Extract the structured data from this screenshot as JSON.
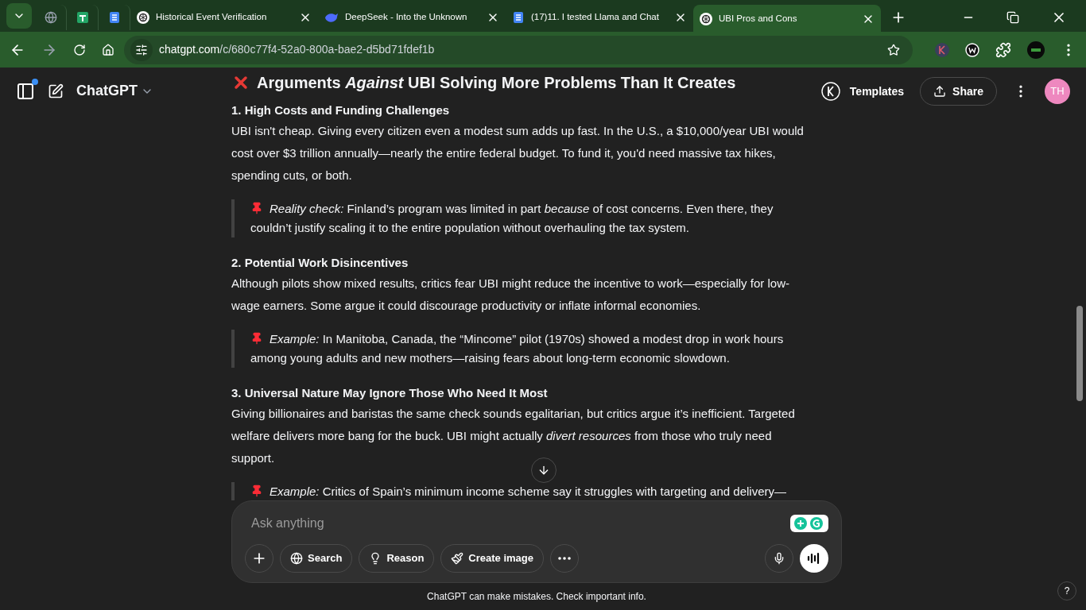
{
  "browser": {
    "tabs": [
      {
        "kind": "pinned",
        "selected": false
      },
      {
        "kind": "pinned",
        "selected": false
      },
      {
        "kind": "pinned",
        "selected": false
      },
      {
        "kind": "tab",
        "title": "Historical Event Verification",
        "selected": false
      },
      {
        "kind": "tab",
        "title": "DeepSeek - Into the Unknown",
        "selected": false
      },
      {
        "kind": "tab",
        "title": "(17)11. I tested Llama and Chat",
        "selected": false
      },
      {
        "kind": "tab",
        "title": "UBI Pros and Cons",
        "selected": true
      }
    ],
    "url_host": "chatgpt.com",
    "url_path": "/c/680c77f4-52a0-800a-bae2-d5bd71fdef1b"
  },
  "header": {
    "app_name": "ChatGPT",
    "templates": "Templates",
    "share": "Share",
    "avatar": "TH"
  },
  "article": {
    "heading": "Arguments *Against* UBI Solving More Problems Than It Creates",
    "sections": [
      {
        "title": "1. High Costs and Funding Challenges",
        "body": "UBI isn't cheap. Giving every citizen even a modest sum adds up fast. In the U.S., a $10,000/year UBI would cost over $3 trillion annually—nearly the entire federal budget. To fund it, you'd need massive tax hikes, spending cuts, or both.",
        "quote": "*Reality check:* Finland’s program was limited in part *because* of cost concerns. Even there, they couldn’t justify scaling it to the entire population without overhauling the tax system."
      },
      {
        "title": "2. Potential Work Disincentives",
        "body": "Although pilots show mixed results, critics fear UBI might reduce the incentive to work—especially for low-wage earners. Some argue it could discourage productivity or inflate informal economies.",
        "quote": "*Example:* In Manitoba, Canada, the “Mincome” pilot (1970s) showed a modest drop in work hours among young adults and new mothers—raising fears about long-term economic slowdown."
      },
      {
        "title": "3. Universal Nature May Ignore Those Who Need It Most",
        "body": "Giving billionaires and baristas the same check sounds egalitarian, but critics argue it’s inefficient. Targeted welfare delivers more bang for the buck. UBI might actually *divert resources* from those who truly need support.",
        "quote": "*Example:* Critics of Spain’s minimum income scheme say it struggles with targeting and delivery—"
      }
    ]
  },
  "composer": {
    "placeholder": "Ask anything",
    "tools": [
      {
        "label": "Search"
      },
      {
        "label": "Reason"
      },
      {
        "label": "Create image"
      }
    ]
  },
  "disclaimer": "ChatGPT can make mistakes. Check important info.",
  "help": "?"
}
